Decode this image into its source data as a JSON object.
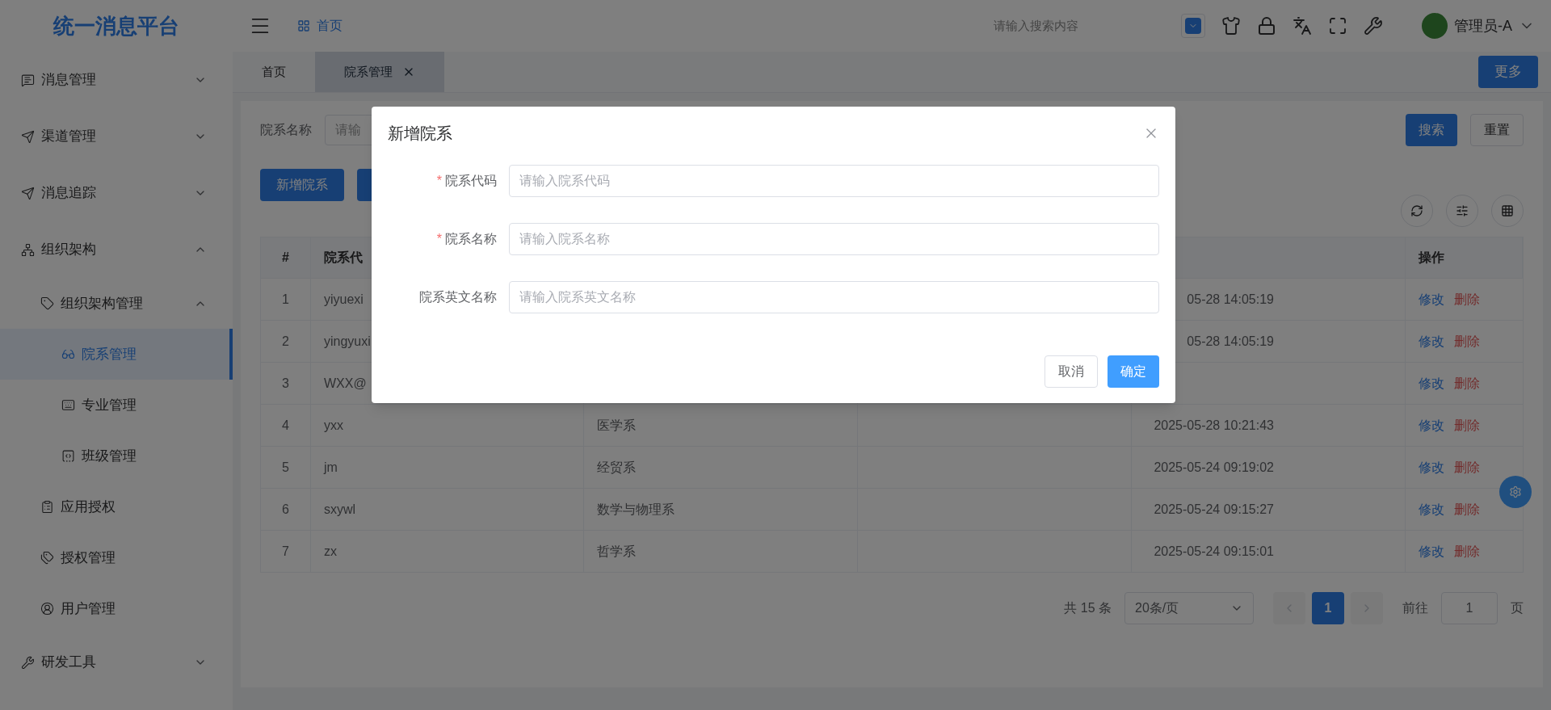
{
  "header": {
    "logo": "统一消息平台",
    "breadcrumb": "首页",
    "search": {
      "placeholder": "请输入搜索内容"
    },
    "user": "管理员-A"
  },
  "sidebar": {
    "items": [
      {
        "label": "消息管理",
        "expanded": false,
        "selected": false
      },
      {
        "label": "渠道管理",
        "expanded": false,
        "selected": false
      },
      {
        "label": "消息追踪",
        "expanded": false,
        "selected": false
      },
      {
        "label": "组织架构",
        "expanded": true,
        "selected": false,
        "children": [
          {
            "label": "组织架构管理",
            "expanded": true,
            "selected": false,
            "children": [
              {
                "label": "院系管理",
                "selected": true
              },
              {
                "label": "专业管理",
                "selected": false
              },
              {
                "label": "班级管理",
                "selected": false
              }
            ]
          },
          {
            "label": "应用授权",
            "selected": false
          },
          {
            "label": "授权管理",
            "selected": false
          },
          {
            "label": "用户管理",
            "selected": false
          }
        ]
      },
      {
        "label": "研发工具",
        "expanded": false,
        "selected": false
      }
    ]
  },
  "tabs": [
    {
      "label": "首页",
      "selected": false,
      "closable": false
    },
    {
      "label": "院系管理",
      "selected": true,
      "closable": true
    }
  ],
  "more_button": "更多",
  "filter": {
    "label": "院系名称",
    "placeholder": "请输",
    "search_button": "搜索",
    "reset_button": "重置"
  },
  "add_button": "新增院系",
  "table": {
    "columns": {
      "column_1": "#",
      "column_2": "院系代",
      "column_6": "操作"
    },
    "rows": [
      {
        "index": "1",
        "code": "yiyuexi",
        "time": "05-28 14:05:19",
        "actions": [
          "修改",
          "删除"
        ]
      },
      {
        "index": "2",
        "code": "yingyuxi",
        "time": "05-28 14:05:19",
        "actions": [
          "修改",
          "删除"
        ]
      },
      {
        "index": "3",
        "code": "WXX@",
        "actions": [
          "修改",
          "删除"
        ]
      },
      {
        "index": "4",
        "code": "yxx",
        "name": "医学系",
        "time": "2025-05-28 10:21:43",
        "actions": [
          "修改",
          "删除"
        ]
      },
      {
        "index": "5",
        "code": "jm",
        "name": "经贸系",
        "time": "2025-05-24 09:19:02",
        "actions": [
          "修改",
          "删除"
        ]
      },
      {
        "index": "6",
        "code": "sxywl",
        "name": "数学与物理系",
        "time": "2025-05-24 09:15:27",
        "actions": [
          "修改",
          "删除"
        ]
      },
      {
        "index": "7",
        "code": "zx",
        "name": "哲学系",
        "time": "2025-05-24 09:15:01",
        "actions": [
          "修改",
          "删除"
        ]
      }
    ]
  },
  "pagination": {
    "total": "共 15 条",
    "page_size": "20条/页",
    "pages": [
      {
        "label": "1",
        "selected": true
      }
    ],
    "goto_label": "前往",
    "goto_value": "1",
    "goto_suffix": "页"
  },
  "dialog": {
    "title": "新增院系",
    "required_mark": "*",
    "fields": [
      {
        "label": "院系代码",
        "required": true,
        "placeholder": "请输入院系代码"
      },
      {
        "label": "院系名称",
        "required": true,
        "placeholder": "请输入院系名称"
      },
      {
        "label": "院系英文名称",
        "required": false,
        "placeholder": "请输入院系英文名称"
      }
    ],
    "buttons": [
      {
        "label": "取消",
        "kind": "secondary"
      },
      {
        "label": "确定",
        "kind": "primary"
      }
    ]
  }
}
